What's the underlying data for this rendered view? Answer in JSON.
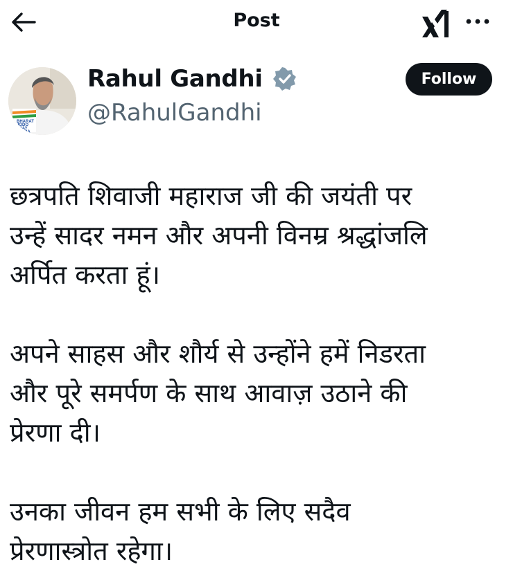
{
  "header": {
    "title": "Post",
    "back_icon": "arrow-left-icon",
    "logo_icon": "x-logo-icon",
    "more_icon": "more-horizontal-icon"
  },
  "author": {
    "name": "Rahul Gandhi",
    "handle": "@RahulGandhi",
    "verified_badge_color": "#829aab",
    "follow_label": "Follow",
    "avatar_sign": [
      "BHARAT",
      "JODO",
      "NYAY",
      "YATRA"
    ]
  },
  "post": {
    "paragraphs": [
      [
        "छत्रपति शिवाजी महाराज जी की जयंती पर",
        "उन्हें सादर नमन और अपनी विनम्र श्रद्धांजलि",
        "अर्पित करता हूं।"
      ],
      [
        "अपने साहस और शौर्य से उन्होंने हमें निडरता",
        "और पूरे समर्पण के साथ आवाज़ उठाने की",
        "प्रेरणा दी।"
      ],
      [
        "उनका जीवन हम सभी के लिए सदैव",
        "प्रेरणास्त्रोत रहेगा।"
      ]
    ]
  },
  "colors": {
    "text": "#0f1419",
    "secondary": "#536471",
    "follow_bg": "#0f1419"
  }
}
